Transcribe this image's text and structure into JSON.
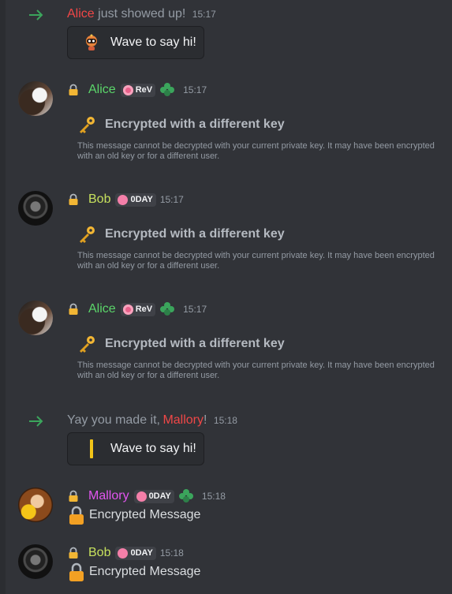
{
  "colors": {
    "background": "#313338",
    "alice_name": "#5bd66a",
    "bob_name": "#c6e05d",
    "mallory_name": "#e255f0",
    "join_name": "#f04747",
    "arrow": "#3ba55c"
  },
  "join1": {
    "name": "Alice",
    "text": "just showed up!",
    "time": "15:17",
    "wave_label": "Wave to say hi!"
  },
  "messages": [
    {
      "author": "Alice",
      "badge": "ReV",
      "time": "15:17",
      "title": "Encrypted with a different key",
      "description": "This message cannot be decrypted with your current private key. It may have been encrypted with an old key or for a different user."
    },
    {
      "author": "Bob",
      "badge": "0DAY",
      "time": "15:17",
      "title": "Encrypted with a different key",
      "description": "This message cannot be decrypted with your current private key. It may have been encrypted with an old key or for a different user."
    },
    {
      "author": "Alice",
      "badge": "ReV",
      "time": "15:17",
      "title": "Encrypted with a different key",
      "description": "This message cannot be decrypted with your current private key. It may have been encrypted with an old key or for a different user."
    }
  ],
  "join2": {
    "prefix": "Yay you made it,",
    "name": "Mallory",
    "suffix": "!",
    "time": "15:18",
    "wave_label": "Wave to say hi!"
  },
  "messages2": [
    {
      "author": "Mallory",
      "badge": "0DAY",
      "time": "15:18",
      "text": "Encrypted Message"
    },
    {
      "author": "Bob",
      "badge": "0DAY",
      "time": "15:18",
      "text": "Encrypted Message"
    }
  ]
}
